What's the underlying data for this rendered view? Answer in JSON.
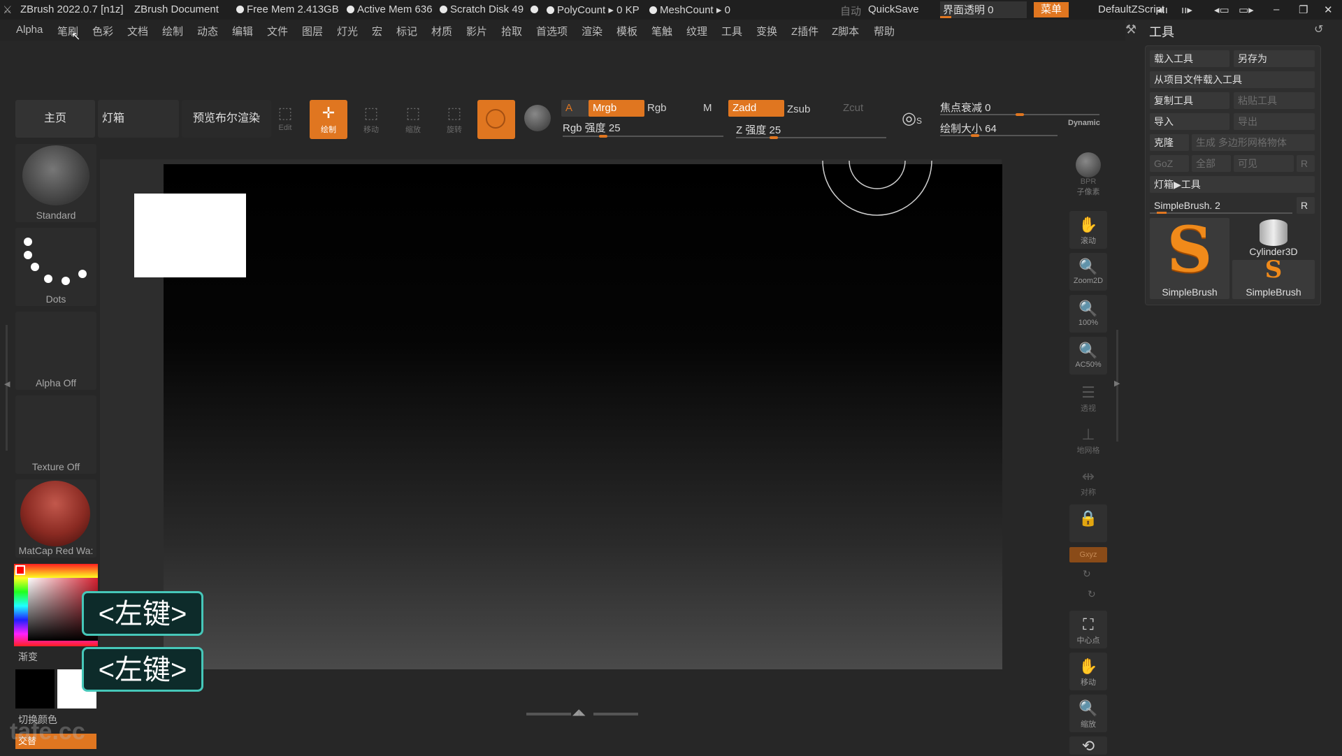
{
  "title_bar": {
    "app_title": "ZBrush 2022.0.7 [n1z]",
    "document": "ZBrush Document",
    "free_mem": "Free Mem 2.413GB",
    "active_mem": "Active Mem 636",
    "scratch_disk": "Scratch Disk 49",
    "poly_count": "PolyCount ▸ 0 KP",
    "mesh_count": "MeshCount ▸ 0",
    "auto_label": "自动",
    "quicksave": "QuickSave",
    "ui_transparency": "界面透明 0",
    "menu_button": "菜单",
    "default_zscript": "DefaultZScript"
  },
  "menu_bar": [
    "Alpha",
    "笔刷",
    "色彩",
    "文档",
    "绘制",
    "动态",
    "编辑",
    "文件",
    "图层",
    "灯光",
    "宏",
    "标记",
    "材质",
    "影片",
    "拾取",
    "首选项",
    "渲染",
    "模板",
    "笔触",
    "纹理",
    "工具",
    "变换",
    "Z插件",
    "Z脚本",
    "帮助"
  ],
  "toolbar": {
    "home_tab": "主页",
    "lightbox_tab": "灯箱",
    "bpr_tab": "预览布尔渲染",
    "edit_label": "Edit",
    "draw_label": "绘制",
    "move_label": "移动",
    "scale_label": "缩放",
    "rotate_label": "旋转",
    "a_label": "A",
    "mrgb_label": "Mrgb",
    "rgb_label": "Rgb",
    "m_label": "M",
    "zadd_label": "Zadd",
    "zsub_label": "Zsub",
    "zcut_label": "Zcut",
    "rgb_intensity": "Rgb 强度 25",
    "z_intensity": "Z 强度 25",
    "focal_shift": "焦点衰减 0",
    "draw_size": "绘制大小 64",
    "dynamic": "Dynamic",
    "sliders": {
      "rgb_intensity": 0.25,
      "z_intensity": 0.25,
      "focal_shift": 0.5,
      "draw_size": 0.3
    }
  },
  "left_panel": {
    "brush": "Standard",
    "stroke": "Dots",
    "alpha": "Alpha Off",
    "texture": "Texture Off",
    "material": "MatCap Red Wa:",
    "gradient_label": "渐变",
    "switch_color_label": "切换颜色",
    "alternate_label": "交替"
  },
  "key_overlays": [
    "<左键>",
    "<左键>"
  ],
  "right_shelf": [
    "BPR",
    "子像素",
    "滚动",
    "Zoom2D",
    "100%",
    "AC50%",
    "透视",
    "地网格",
    "对称",
    "",
    "Gxyz",
    "",
    "",
    "中心点",
    "移动",
    "缩放",
    ""
  ],
  "tool_panel": {
    "header": "工具",
    "load_tool": "载入工具",
    "save_as": "另存为",
    "load_from_project": "从项目文件载入工具",
    "copy_tool": "复制工具",
    "paste_tool": "粘贴工具",
    "import": "导入",
    "export": "导出",
    "clone": "克隆",
    "make_polymesh": "生成 多边形网格物体",
    "goz": "GoZ",
    "all": "全部",
    "visible": "可见",
    "r_label": "R",
    "lightbox_tools": "灯箱▶工具",
    "current_tool": "SimpleBrush. 2",
    "tools": [
      "SimpleBrush",
      "Cylinder3D",
      "SimpleBrush"
    ]
  },
  "watermark": "tafe.cc",
  "colors": {
    "accent": "#e07620",
    "keycap_border": "#46c7b9",
    "panel": "#2e2e2e"
  }
}
